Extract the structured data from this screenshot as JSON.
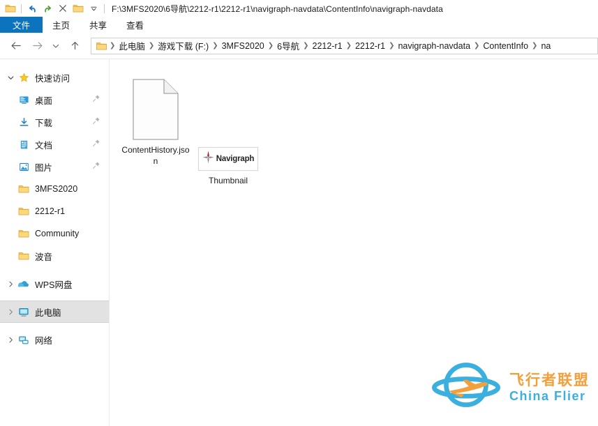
{
  "window": {
    "title_path": "F:\\3MFS2020\\6导航\\2212-r1\\2212-r1\\navigraph-navdata\\ContentInfo\\navigraph-navdata"
  },
  "quick_access_toolbar": {
    "items": [
      {
        "name": "explorer-folder-icon",
        "label": "资源管理器"
      },
      {
        "name": "undo-icon",
        "label": "撤消"
      },
      {
        "name": "redo-icon",
        "label": "恢复"
      },
      {
        "name": "delete-icon",
        "label": "删除"
      },
      {
        "name": "new-folder-icon",
        "label": "新建文件夹"
      },
      {
        "name": "customize-chevron-icon",
        "label": "自定义快速访问工具栏"
      }
    ]
  },
  "ribbon": {
    "tabs": [
      {
        "label": "文件",
        "active": true
      },
      {
        "label": "主页",
        "active": false
      },
      {
        "label": "共享",
        "active": false
      },
      {
        "label": "查看",
        "active": false
      }
    ],
    "active_color": "#0c74bd"
  },
  "navbar": {
    "back_label": "后退",
    "forward_label": "前进",
    "recent_label": "最近浏览的位置",
    "up_label": "上移一级",
    "breadcrumb": [
      "此电脑",
      "游戏下载 (F:)",
      "3MFS2020",
      "6导航",
      "2212-r1",
      "2212-r1",
      "navigraph-navdata",
      "ContentInfo",
      "na"
    ]
  },
  "sidebar": {
    "groups": [
      {
        "name": "quick-access",
        "label": "快速访问",
        "icon": "star-icon",
        "expanded": true,
        "chevron": "chevron-down-icon",
        "children": [
          {
            "label": "桌面",
            "icon": "desktop-icon",
            "pinned": true
          },
          {
            "label": "下载",
            "icon": "downloads-icon",
            "pinned": true
          },
          {
            "label": "文档",
            "icon": "documents-icon",
            "pinned": true
          },
          {
            "label": "图片",
            "icon": "pictures-icon",
            "pinned": true
          },
          {
            "label": "3MFS2020",
            "icon": "folder-icon",
            "pinned": false
          },
          {
            "label": "2212-r1",
            "icon": "folder-icon",
            "pinned": false
          },
          {
            "label": "Community",
            "icon": "folder-icon",
            "pinned": false
          },
          {
            "label": "波音",
            "icon": "folder-icon",
            "pinned": false
          }
        ]
      },
      {
        "name": "wps-cloud",
        "label": "WPS网盘",
        "icon": "cloud-icon",
        "expanded": false,
        "chevron": "chevron-right-icon",
        "selected": false,
        "children": []
      },
      {
        "name": "this-pc",
        "label": "此电脑",
        "icon": "computer-icon",
        "expanded": false,
        "chevron": "chevron-right-icon",
        "selected": true,
        "children": []
      },
      {
        "name": "network",
        "label": "网络",
        "icon": "network-icon",
        "expanded": false,
        "chevron": "chevron-right-icon",
        "selected": false,
        "children": []
      }
    ]
  },
  "content": {
    "items": [
      {
        "name": "ContentHistory.json",
        "icon": "json-file-icon",
        "type": "file"
      },
      {
        "name": "Thumbnail",
        "icon": "navigraph-thumbnail",
        "type": "image",
        "thumb_text": "Navigraph"
      }
    ]
  },
  "watermark": {
    "cn": "飞行者联盟",
    "en": "China Flier",
    "brand_blue": "#3BAFDE",
    "brand_orange": "#F2A03C"
  }
}
